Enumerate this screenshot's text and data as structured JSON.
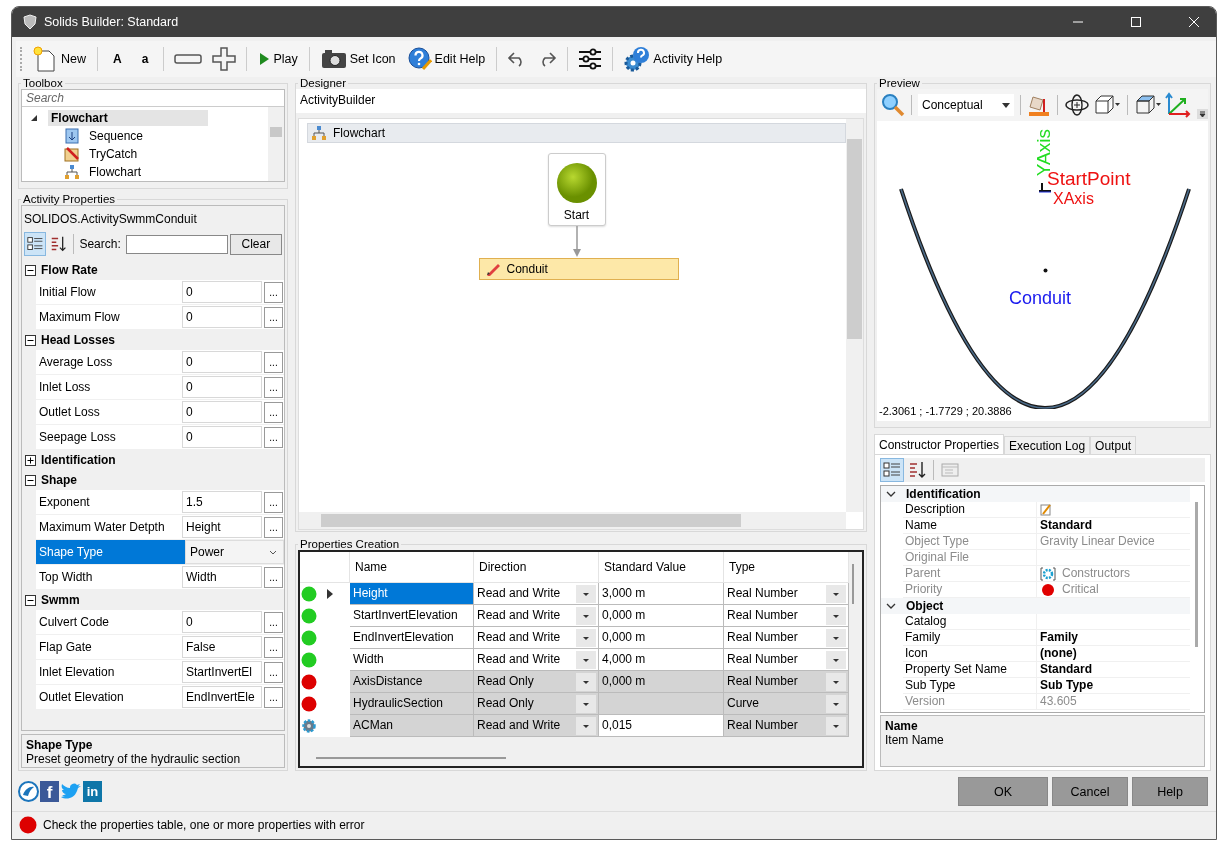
{
  "window": {
    "title": "Solids Builder: Standard"
  },
  "toolbar": {
    "new": "New",
    "font_larger": "A",
    "font_smaller": "a",
    "play": "Play",
    "set_icon": "Set Icon",
    "edit_help": "Edit Help",
    "activity_help": "Activity Help"
  },
  "toolbox": {
    "title": "Toolbox",
    "search": {
      "placeholder": "Search"
    },
    "tree": [
      {
        "label": "Flowchart",
        "expanded": true,
        "selected": true,
        "children": [
          {
            "label": "Sequence",
            "selected": false
          },
          {
            "label": "TryCatch",
            "selected": false
          },
          {
            "label": "Flowchart",
            "selected": false
          }
        ]
      }
    ]
  },
  "activity_properties": {
    "title": "Activity Properties",
    "type_name": "SOLIDOS.ActivitySwmmConduit",
    "search_label": "Search:",
    "clear": "Clear",
    "ellipsis": "...",
    "categories": [
      {
        "name": "Flow Rate",
        "expanded": true,
        "props": [
          {
            "name": "Initial Flow",
            "value": "0",
            "kind": "button",
            "selected": false
          },
          {
            "name": "Maximum Flow",
            "value": "0",
            "kind": "button",
            "selected": false
          }
        ]
      },
      {
        "name": "Head Losses",
        "expanded": true,
        "props": [
          {
            "name": "Average Loss",
            "value": "0",
            "kind": "button",
            "selected": false
          },
          {
            "name": "Inlet Loss",
            "value": "0",
            "kind": "button",
            "selected": false
          },
          {
            "name": "Outlet Loss",
            "value": "0",
            "kind": "button",
            "selected": false
          },
          {
            "name": "Seepage Loss",
            "value": "0",
            "kind": "button",
            "selected": false
          }
        ]
      },
      {
        "name": "Identification",
        "expanded": false
      },
      {
        "name": "Shape",
        "expanded": true,
        "props": [
          {
            "name": "Exponent",
            "value": "1.5",
            "kind": "button",
            "selected": false
          },
          {
            "name": "Maximum Water Detpth",
            "value": "Height",
            "kind": "button",
            "selected": false
          },
          {
            "name": "Shape Type",
            "value": "Power",
            "kind": "dropdown",
            "selected": true
          },
          {
            "name": "Top Width",
            "value": "Width",
            "kind": "button",
            "selected": false
          }
        ]
      },
      {
        "name": "Swmm",
        "expanded": true,
        "props": [
          {
            "name": "Culvert Code",
            "value": "0",
            "kind": "button",
            "selected": false
          },
          {
            "name": "Flap Gate",
            "value": "False",
            "kind": "button",
            "selected": false
          },
          {
            "name": "Inlet Elevation",
            "value": "StartInvertEl",
            "kind": "button",
            "selected": false
          },
          {
            "name": "Outlet Elevation",
            "value": "EndInvertEle",
            "kind": "button",
            "selected": false
          }
        ]
      }
    ],
    "help": {
      "title": "Shape Type",
      "text": "Preset geometry of the hydraulic section"
    }
  },
  "designer": {
    "title": "Designer",
    "breadcrumb": "ActivityBuilder",
    "flowchart": "Flowchart",
    "start_node": "Start",
    "activity": "Conduit"
  },
  "properties_creation": {
    "title": "Properties Creation",
    "columns": [
      "Name",
      "Direction",
      "Standard Value",
      "Type"
    ],
    "rows": [
      {
        "kind": "dot",
        "color": "#22cc22",
        "name": "Height",
        "direction": "Read and Write",
        "value": "3,000 m",
        "type": "Real Number",
        "selected": true,
        "locked": false,
        "value_locked": false
      },
      {
        "kind": "dot",
        "color": "#22cc22",
        "name": "StartInvertElevation",
        "direction": "Read and Write",
        "value": "0,000 m",
        "type": "Real Number",
        "selected": false,
        "locked": false,
        "value_locked": false
      },
      {
        "kind": "dot",
        "color": "#22cc22",
        "name": "EndInvertElevation",
        "direction": "Read and Write",
        "value": "0,000 m",
        "type": "Real Number",
        "selected": false,
        "locked": false,
        "value_locked": false
      },
      {
        "kind": "dot",
        "color": "#22cc22",
        "name": "Width",
        "direction": "Read and Write",
        "value": "4,000 m",
        "type": "Real Number",
        "selected": false,
        "locked": false,
        "value_locked": false
      },
      {
        "kind": "dot",
        "color": "#dd0000",
        "name": "AxisDistance",
        "direction": "Read Only",
        "value": "0,000 m",
        "type": "Real Number",
        "selected": false,
        "locked": true,
        "value_locked": true
      },
      {
        "kind": "dot",
        "color": "#dd0000",
        "name": "HydraulicSection",
        "direction": "Read Only",
        "type": "Curve",
        "selected": false,
        "locked": true,
        "value_locked": true
      },
      {
        "kind": "gear",
        "name": "ACMan",
        "direction": "Read and Write",
        "value": "0,015",
        "type": "Real Number",
        "selected": false,
        "locked": true,
        "value_locked": false
      }
    ]
  },
  "preview": {
    "title": "Preview",
    "view_mode": "Conceptual",
    "labels": {
      "y_axis": "YAxis",
      "start_point": "StartPoint",
      "x_axis": "XAxis",
      "conduit": "Conduit"
    },
    "coordinates": "-2.3061 ; -1.7729 ; 20.3886"
  },
  "tabs": [
    {
      "label": "Constructor Properties",
      "selected": true
    },
    {
      "label": "Execution Log",
      "selected": false
    },
    {
      "label": "Output",
      "selected": false
    }
  ],
  "constructor_properties": {
    "categories": [
      {
        "name": "Identification",
        "expanded": true,
        "props": [
          {
            "name": "Description",
            "kind": "edit",
            "disabled": false
          },
          {
            "name": "Name",
            "value": "Standard",
            "kind": "text",
            "bold": true,
            "disabled": false
          },
          {
            "name": "Object Type",
            "value": "Gravity Linear Device",
            "kind": "text",
            "bold": false,
            "disabled": true
          },
          {
            "name": "Original File",
            "kind": "text",
            "disabled": true
          },
          {
            "name": "Parent",
            "value": "Constructors",
            "kind": "gear",
            "bold": false,
            "disabled": true
          },
          {
            "name": "Priority",
            "value": "Critical",
            "kind": "dot",
            "color": "#e00000",
            "bold": false,
            "disabled": true
          }
        ]
      },
      {
        "name": "Object",
        "expanded": true,
        "props": [
          {
            "name": "Catalog",
            "kind": "text",
            "disabled": false
          },
          {
            "name": "Family",
            "value": "Family",
            "kind": "text",
            "bold": true,
            "disabled": false
          },
          {
            "name": "Icon",
            "value": "(none)",
            "kind": "text",
            "bold": true,
            "disabled": false
          },
          {
            "name": "Property Set Name",
            "value": "Standard",
            "kind": "text",
            "bold": true,
            "disabled": false
          },
          {
            "name": "Sub Type",
            "value": "Sub Type",
            "kind": "text",
            "bold": true,
            "disabled": false
          },
          {
            "name": "Version",
            "value": "43.605",
            "kind": "text",
            "bold": false,
            "disabled": true
          }
        ]
      }
    ],
    "help": {
      "title": "Name",
      "text": "Item Name"
    }
  },
  "social": [
    {
      "kind": "site"
    },
    {
      "kind": "facebook",
      "label": "f"
    },
    {
      "kind": "twitter"
    },
    {
      "kind": "linkedin",
      "label": "in"
    }
  ],
  "buttons": [
    "OK",
    "Cancel",
    "Help"
  ],
  "status_bar": {
    "color": "#dd0000",
    "message": "Check the properties table, one or more properties with error"
  }
}
